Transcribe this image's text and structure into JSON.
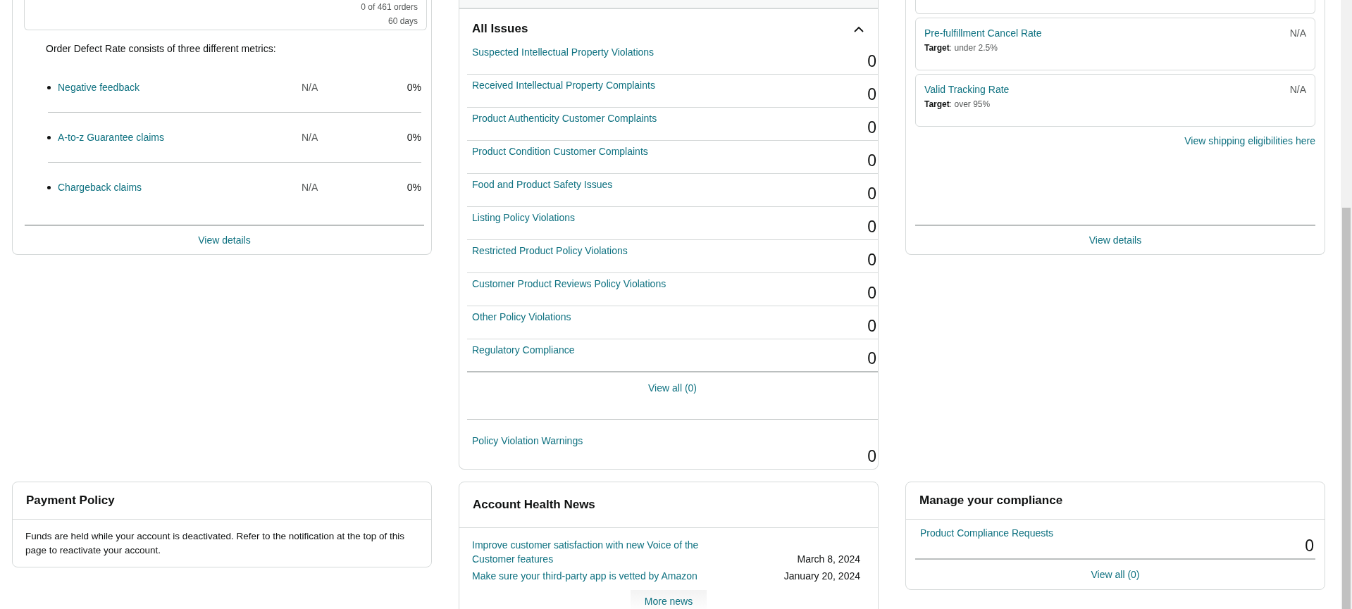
{
  "order_defect": {
    "orders": "0 of 461 orders",
    "period": "60 days",
    "intro": "Order Defect Rate consists of three different metrics:",
    "metrics": [
      {
        "label": "Negative feedback",
        "status": "N/A",
        "value": "0%"
      },
      {
        "label": "A-to-z Guarantee claims",
        "status": "N/A",
        "value": "0%"
      },
      {
        "label": "Chargeback claims",
        "status": "N/A",
        "value": "0%"
      }
    ],
    "link": "View details"
  },
  "all_issues": {
    "title": "All Issues",
    "expanded": true,
    "rows": [
      {
        "label": "Suspected Intellectual Property Violations",
        "count": "0"
      },
      {
        "label": "Received Intellectual Property Complaints",
        "count": "0"
      },
      {
        "label": "Product Authenticity Customer Complaints",
        "count": "0"
      },
      {
        "label": "Product Condition Customer Complaints",
        "count": "0"
      },
      {
        "label": "Food and Product Safety Issues",
        "count": "0"
      },
      {
        "label": "Listing Policy Violations",
        "count": "0"
      },
      {
        "label": "Restricted Product Policy Violations",
        "count": "0"
      },
      {
        "label": "Customer Product Reviews Policy Violations",
        "count": "0"
      },
      {
        "label": "Other Policy Violations",
        "count": "0"
      },
      {
        "label": "Regulatory Compliance",
        "count": "0"
      }
    ],
    "view_all": "View all (0)",
    "warnings": {
      "label": "Policy Violation Warnings",
      "count": "0"
    }
  },
  "shipping": {
    "metrics": [
      {
        "label": "Pre-fulfillment Cancel Rate",
        "value": "N/A",
        "target": "**Target**: under 2.5%"
      },
      {
        "label": "Valid Tracking Rate",
        "value": "N/A",
        "target": "**Target**: over 95%"
      }
    ],
    "eligibility_link": "View shipping eligibilities here",
    "link": "View details"
  },
  "payment_policy": {
    "title": "Payment Policy",
    "text": "Funds are held while your account is deactivated. Refer to the notification at the top of this page to reactivate your account."
  },
  "news": {
    "title": "Account Health News",
    "items": [
      {
        "title": "Improve customer satisfaction with new Voice of the Customer features",
        "date": "March 8, 2024"
      },
      {
        "title": "Make sure your third-party app is vetted by Amazon",
        "date": "January 20, 2024"
      }
    ],
    "more": "More news"
  },
  "compliance": {
    "title": "Manage your compliance",
    "rows": [
      {
        "label": "Product Compliance Requests",
        "count": "0"
      }
    ],
    "view_all": "View all (0)"
  }
}
